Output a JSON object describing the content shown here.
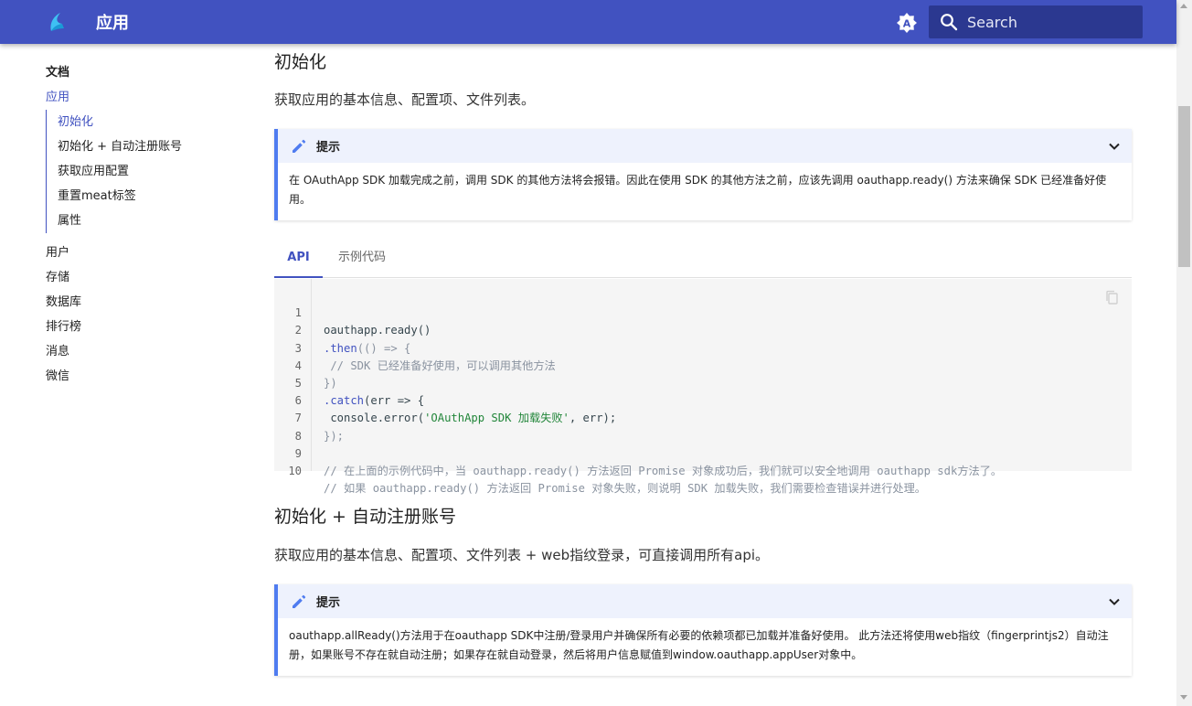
{
  "header": {
    "title": "应用",
    "search_placeholder": "Search",
    "logo_icon": "wave-logo-icon",
    "theme_icon": "brightness-auto-icon",
    "color": "#4152c0"
  },
  "sidebar": {
    "section_docs": "文档",
    "active_item": "应用",
    "sub_items": [
      "初始化",
      "初始化 + 自动注册账号",
      "获取应用配置",
      "重置meat标签",
      "属性"
    ],
    "items": [
      "用户",
      "存储",
      "数据库",
      "排行榜",
      "消息",
      "微信"
    ]
  },
  "sections": [
    {
      "title": "初始化",
      "description": "获取应用的基本信息、配置项、文件列表。",
      "tip_title": "提示",
      "tip_body": "在 OAuthApp SDK 加载完成之前，调用 SDK 的其他方法将会报错。因此在使用 SDK 的其他方法之前，应该先调用 oauthapp.ready() 方法来确保 SDK 已经准备好使用。"
    },
    {
      "title": "初始化 + 自动注册账号",
      "description": "获取应用的基本信息、配置项、文件列表 + web指纹登录，可直接调用所有api。",
      "tip_title": "提示",
      "tip_body": "oauthapp.allReady()方法用于在oauthapp SDK中注册/登录用户并确保所有必要的依赖项都已加载并准备好使用。 此方法还将使用web指纹（fingerprintjs2）自动注册，如果账号不存在就自动注册；如果存在就自动登录，然后将用户信息赋值到window.oauthapp.appUser对象中。"
    }
  ],
  "tabs": {
    "api": "API",
    "example": "示例代码"
  },
  "code": {
    "line_numbers": [
      "1",
      "2",
      "3",
      "4",
      "5",
      "6",
      "7",
      "8",
      "9",
      "10"
    ],
    "l1": "oauthapp.ready()",
    "l2a": ".then",
    "l2b": "(() => {",
    "l3": " // SDK 已经准备好使用，可以调用其他方法",
    "l4": "})",
    "l5a": ".catch",
    "l5b": "(err => {",
    "l6a": " console.error(",
    "l6b": "'OAuthApp SDK 加载失败'",
    "l6c": ", err);",
    "l7": "});",
    "l9": "// 在上面的示例代码中，当 oauthapp.ready() 方法返回 Promise 对象成功后，我们就可以安全地调用 oauthapp sdk方法了。",
    "l10": "// 如果 oauthapp.ready() 方法返回 Promise 对象失败，则说明 SDK 加载失败，我们需要检查错误并进行处理。"
  }
}
